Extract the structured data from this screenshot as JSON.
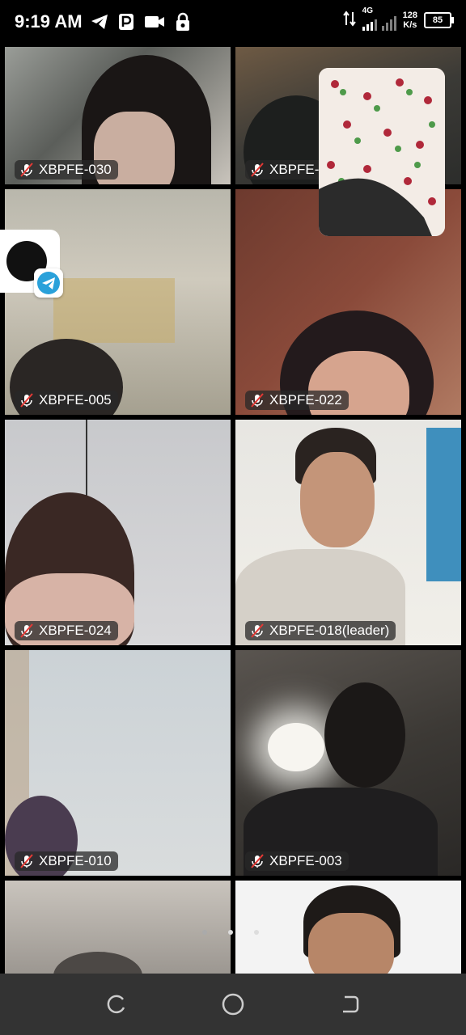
{
  "status_bar": {
    "time": "9:19 AM",
    "network_type": "4G",
    "speed_value": "128",
    "speed_unit": "K/s",
    "battery": "85",
    "icons": [
      "telegram-icon",
      "parking-icon",
      "video-icon",
      "lock-icon",
      "data-arrows-icon",
      "signal-icon"
    ]
  },
  "participants": [
    {
      "name": "XBPFE-030",
      "muted": true
    },
    {
      "name": "XBPFE-0",
      "muted": true
    },
    {
      "name": "XBPFE-005",
      "muted": true
    },
    {
      "name": "XBPFE-022",
      "muted": true
    },
    {
      "name": "XBPFE-024",
      "muted": true
    },
    {
      "name": "XBPFE-018(leader)",
      "muted": true
    },
    {
      "name": "XBPFE-010",
      "muted": true
    },
    {
      "name": "XBPFE-003",
      "muted": true
    }
  ],
  "pagination": {
    "pages": 3,
    "current": 1
  },
  "colors": {
    "telegram_blue": "#2aa1da",
    "mute_red": "#e53935",
    "label_bg": "#282828"
  },
  "navigation": {
    "buttons": [
      "recents-button",
      "home-button",
      "back-button"
    ]
  }
}
